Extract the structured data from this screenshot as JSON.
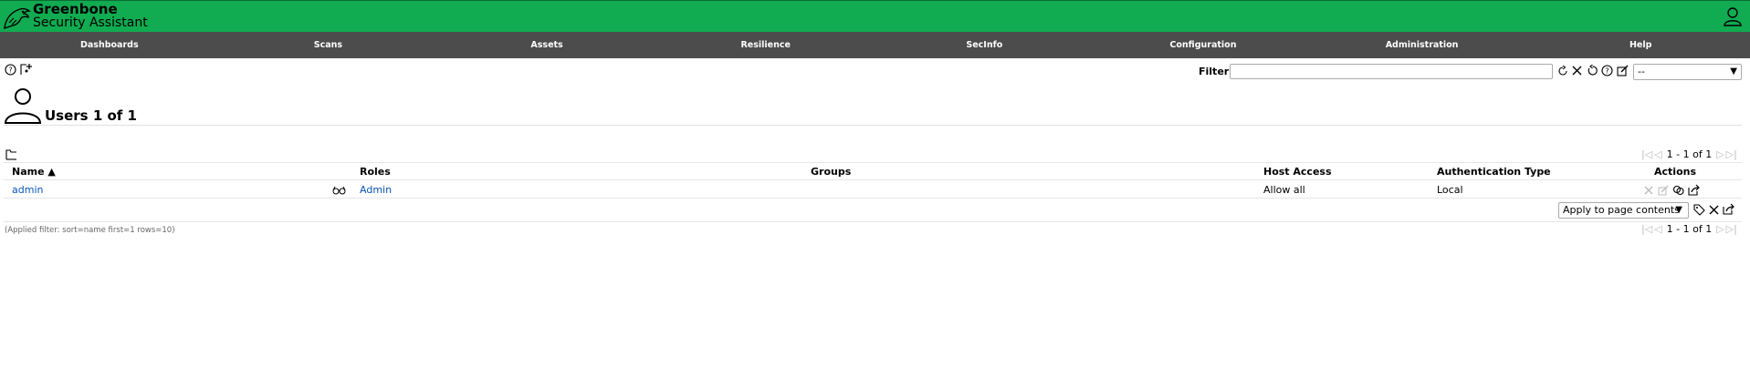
{
  "header": {
    "brand_line1": "Greenbone",
    "brand_line2": "Security Assistant",
    "brand_color": "#11ab51",
    "nav_color": "#4c4c4c"
  },
  "nav": {
    "items": [
      "Dashboards",
      "Scans",
      "Assets",
      "Resilience",
      "SecInfo",
      "Configuration",
      "Administration",
      "Help"
    ]
  },
  "toolbar": {
    "help_icon": "help-icon",
    "new_icon": "new-user-icon"
  },
  "filter": {
    "label": "Filter",
    "value": "",
    "placeholder": "",
    "selected": "--"
  },
  "page": {
    "title": "Users 1 of 1",
    "icon": "user-icon"
  },
  "table": {
    "pagination": "1 - 1 of 1",
    "columns": {
      "name": "Name ▲",
      "roles": "Roles",
      "groups": "Groups",
      "host_access": "Host Access",
      "auth_type": "Authentication Type",
      "actions": "Actions"
    },
    "rows": [
      {
        "name": "admin",
        "roles": "Admin",
        "groups": "",
        "host_access": "Allow all",
        "auth_type": "Local"
      }
    ],
    "apply_label": "Apply to page contents",
    "applied_filter": "(Applied filter: sort=name first=1 rows=10)",
    "link_color": "#0a53b7"
  }
}
